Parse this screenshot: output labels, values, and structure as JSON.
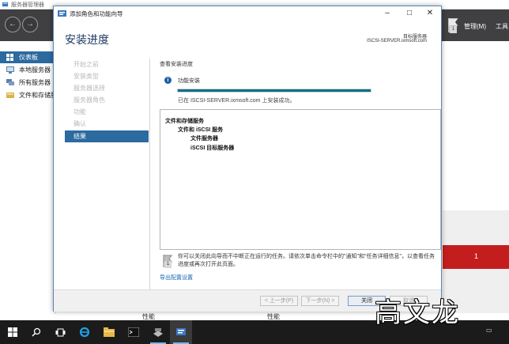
{
  "server_manager": {
    "window_title": "服务器管理器",
    "menus": [
      "管理(M)",
      "工具"
    ],
    "notification_count": "1",
    "sidebar": [
      {
        "label": "仪表板",
        "icon": "dashboard-icon",
        "active": true
      },
      {
        "label": "本地服务器",
        "icon": "server-icon",
        "active": false
      },
      {
        "label": "所有服务器",
        "icon": "servers-icon",
        "active": false
      },
      {
        "label": "文件和存储服务",
        "icon": "storage-icon",
        "active": false
      }
    ],
    "alert_count": "1",
    "column_labels": [
      "性能",
      "性能"
    ]
  },
  "wizard": {
    "title": "添加角色和功能向导",
    "heading": "安装进度",
    "target_label": "目标服务器",
    "target_server": "ISCSI-SERVER.ixmsoft.com",
    "steps": [
      {
        "label": "开始之前",
        "active": false
      },
      {
        "label": "安装类型",
        "active": false
      },
      {
        "label": "服务器选择",
        "active": false
      },
      {
        "label": "服务器角色",
        "active": false
      },
      {
        "label": "功能",
        "active": false
      },
      {
        "label": "确认",
        "active": false
      },
      {
        "label": "结果",
        "active": true
      }
    ],
    "content_title": "查看安装进度",
    "info_label": "功能安装",
    "progress": 1.0,
    "success_message": "已在 ISCSI-SERVER.ixmsoft.com 上安装成功。",
    "results": [
      {
        "text": "文件和存储服务",
        "level": 0
      },
      {
        "text": "文件和 iSCSI 服务",
        "level": 1
      },
      {
        "text": "文件服务器",
        "level": 2
      },
      {
        "text": "iSCSI 目标服务器",
        "level": 2
      }
    ],
    "note_badge": "1",
    "note": "你可以关闭此向导而不中断正在运行的任务。请依次单击命令栏中的\"通知\"和\"任务详细信息\"，以查看任务进度或再次打开此页面。",
    "export_link": "导出配置设置",
    "buttons": {
      "previous": "< 上一步(P)",
      "next": "下一步(N) >",
      "close": "关闭",
      "cancel": "取消"
    }
  },
  "watermark": "高文龙"
}
